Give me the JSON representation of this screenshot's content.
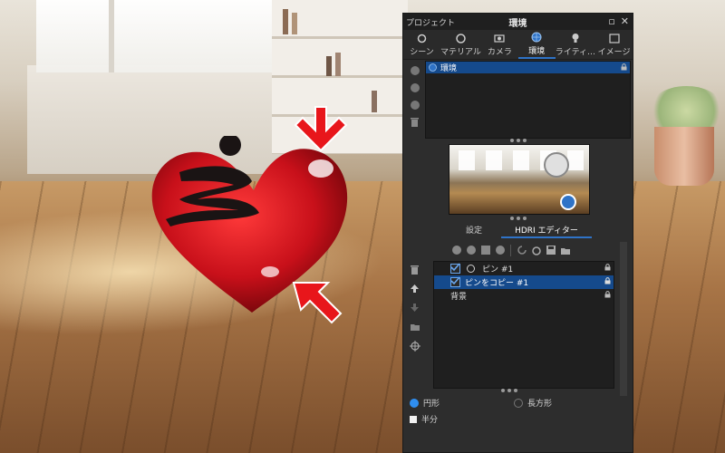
{
  "panel": {
    "title_left": "プロジェクト",
    "title_center": "環境",
    "tabs": [
      {
        "label": "シーン",
        "icon": "scene-icon"
      },
      {
        "label": "マテリアル",
        "icon": "material-icon"
      },
      {
        "label": "カメラ",
        "icon": "camera-icon"
      },
      {
        "label": "環境",
        "icon": "environment-globe-icon",
        "active": true
      },
      {
        "label": "ライティ…",
        "icon": "lighting-bulb-icon"
      },
      {
        "label": "イメージ",
        "icon": "image-icon"
      }
    ],
    "environment_list": [
      {
        "label": "環境",
        "selected": true,
        "locked": true
      }
    ],
    "subtabs": [
      {
        "label": "設定",
        "active": false
      },
      {
        "label": "HDRI エディター",
        "active": true
      }
    ],
    "pins": [
      {
        "label": "ピン #1",
        "checked": true,
        "selected": false,
        "locked": true
      },
      {
        "label": "ピンをコピー #1",
        "checked": true,
        "selected": true,
        "locked": true
      },
      {
        "label": "背景",
        "checked": false,
        "selected": false,
        "locked": true
      }
    ],
    "shape_options": {
      "circle_label": "円形",
      "rect_label": "長方形",
      "selected": "円形"
    },
    "partial_label": "半分"
  },
  "colors": {
    "accent": "#2f73c7",
    "selection": "#154a8c",
    "panel_bg": "#2d2d2d",
    "arrow_red": "#e8161b",
    "heart_red": "#c8101a"
  }
}
